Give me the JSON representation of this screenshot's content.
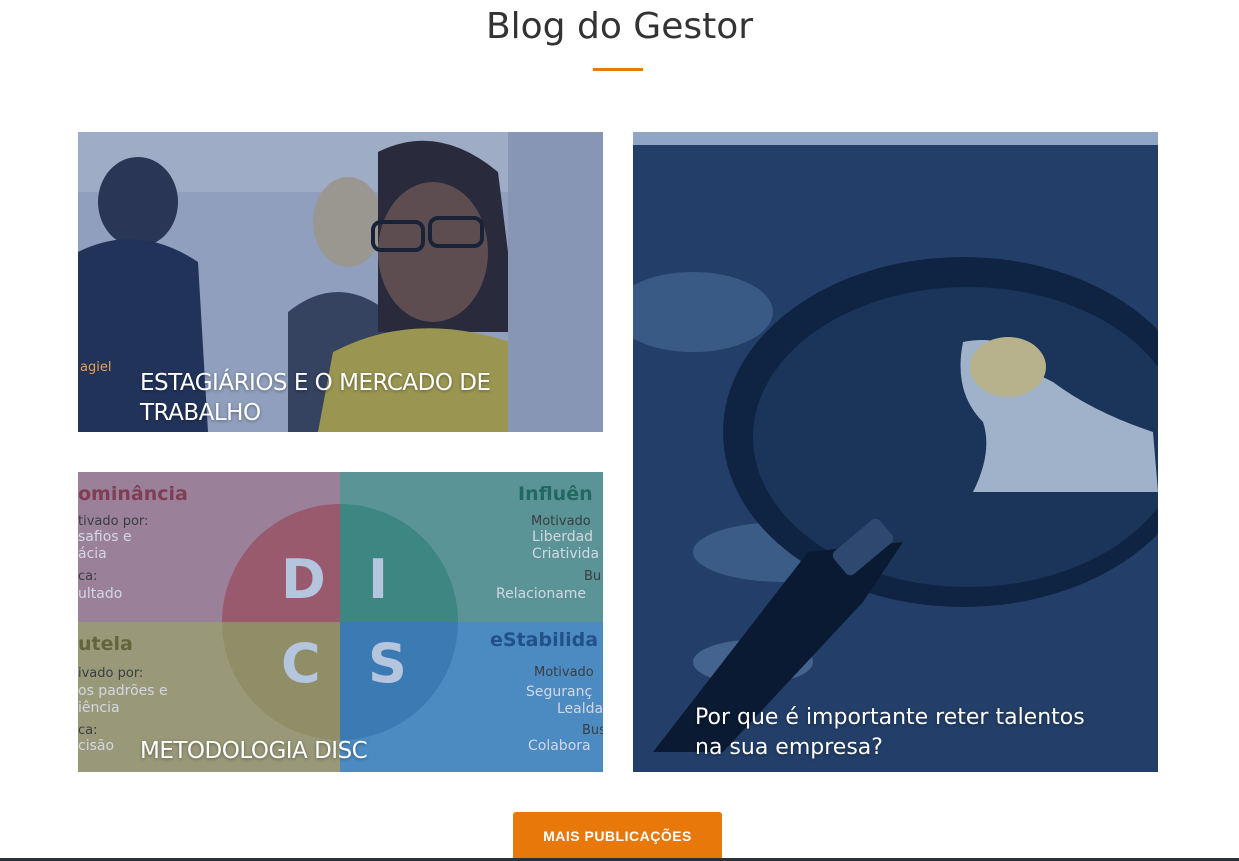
{
  "section": {
    "title": "Blog do Gestor",
    "accent_color": "#e87a0c"
  },
  "cards": [
    {
      "caption": "ESTAGIÁRIOS E O MERCADO DE TRABALHO",
      "logo_text": "agiel",
      "image": "woman-with-glasses-office-photo"
    },
    {
      "caption": "METODOLOGIA DISC",
      "image": "disc-diagram",
      "disc": {
        "letters": [
          "D",
          "I",
          "C",
          "S"
        ],
        "quadrants": {
          "top_left": {
            "heading": "ominância",
            "motivated_label": "tivado por:",
            "motivated_lines": [
              "safios e",
              "ácia"
            ],
            "seeks_label": "ca:",
            "seeks_value": "ultado"
          },
          "top_right": {
            "heading": "Influên",
            "motivated_label": "Motivado",
            "motivated_lines": [
              "Liberdad",
              "Criativida"
            ],
            "seeks_label": "Bu",
            "seeks_value": "Relacioname"
          },
          "bottom_left": {
            "heading": "utela",
            "motivated_label": "ivado por:",
            "motivated_lines": [
              "os padrões e",
              "iência"
            ],
            "seeks_label": "ca:",
            "seeks_value": "cisão"
          },
          "bottom_right": {
            "heading": "eStabilida",
            "motivated_label": "Motivado",
            "motivated_lines": [
              "Seguranç",
              "Lealda"
            ],
            "seeks_label": "Bus",
            "seeks_value": "Colabora"
          }
        }
      }
    },
    {
      "caption": "Por que é importante reter talentos na sua empresa?",
      "image": "magnifying-glass-person-silhouette"
    }
  ],
  "more_button": {
    "label": "MAIS PUBLICAÇÕES",
    "color": "#e8780a"
  }
}
